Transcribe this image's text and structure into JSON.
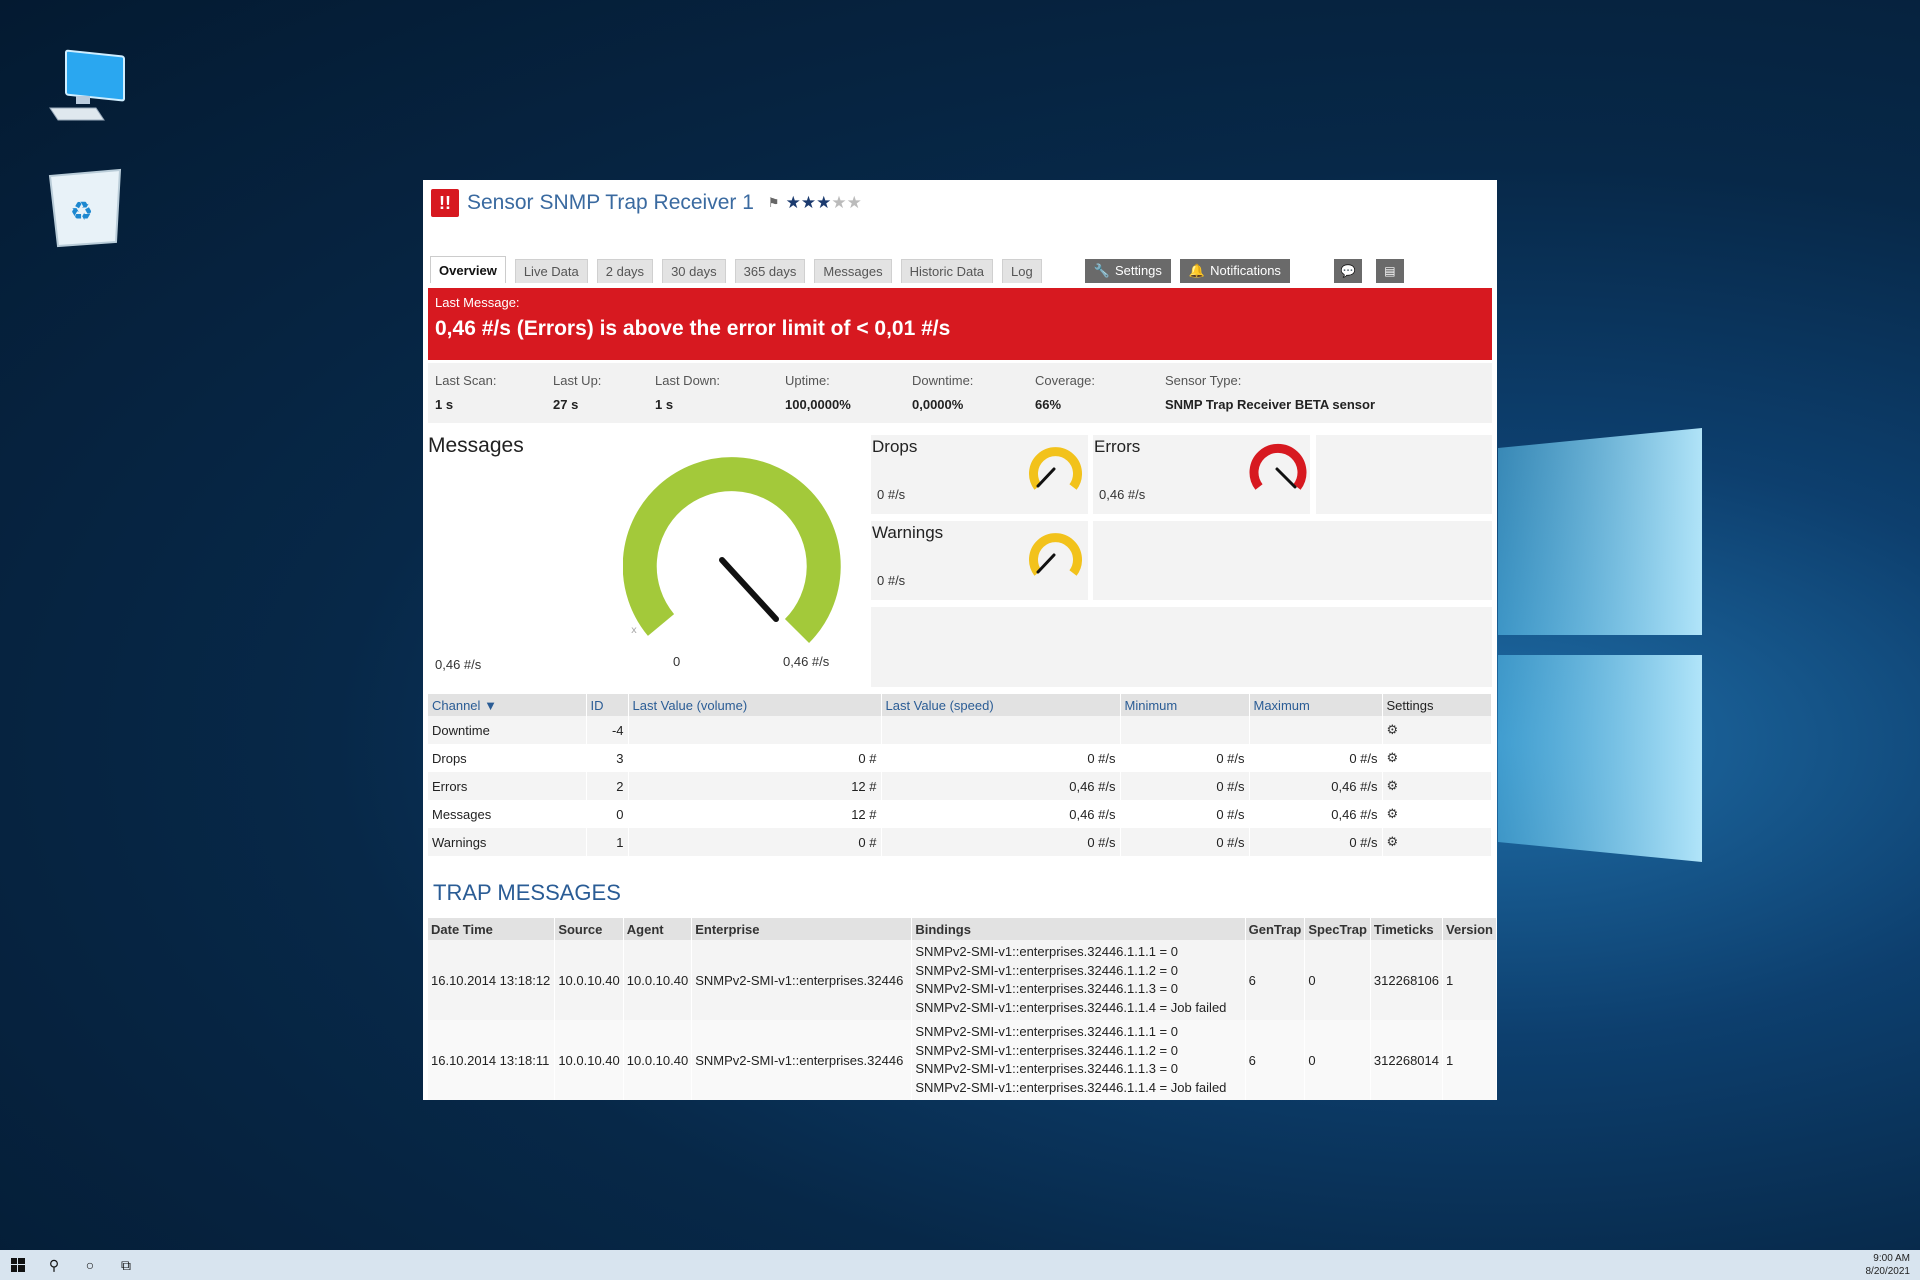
{
  "window": {
    "title_prefix": "Sensor",
    "title_name": "SNMP Trap Receiver 1",
    "status_symbol": "!!",
    "priority_stars_filled": 3,
    "priority_stars_total": 5,
    "colors": {
      "error_red": "#d71920",
      "link_blue": "#2a5c95",
      "gauge_green": "#a3c93a",
      "gauge_yellow": "#f2c21b"
    }
  },
  "tabs": {
    "overview": "Overview",
    "live_data": "Live Data",
    "two_days": "2 days",
    "thirty_days": "30 days",
    "days365": "365 days",
    "messages": "Messages",
    "historic_data": "Historic Data",
    "log": "Log",
    "settings": "Settings",
    "notifications": "Notifications"
  },
  "alert": {
    "label": "Last Message:",
    "text": "0,46 #/s (Errors) is above the error limit of < 0,01 #/s"
  },
  "stats": {
    "last_scan_label": "Last Scan:",
    "last_scan": "1 s",
    "last_up_label": "Last Up:",
    "last_up": "27 s",
    "last_down_label": "Last Down:",
    "last_down": "1 s",
    "uptime_label": "Uptime:",
    "uptime": "100,0000%",
    "downtime_label": "Downtime:",
    "downtime": "0,0000%",
    "coverage_label": "Coverage:",
    "coverage": "66%",
    "sensor_type_label": "Sensor Type:",
    "sensor_type": "SNMP Trap Receiver BETA sensor"
  },
  "gauges": {
    "messages": {
      "title": "Messages",
      "value": "0,46 #/s",
      "min": "0",
      "max": "0,46 #/s"
    },
    "drops": {
      "title": "Drops",
      "value": "0 #/s"
    },
    "errors": {
      "title": "Errors",
      "value": "0,46 #/s"
    },
    "warnings": {
      "title": "Warnings",
      "value": "0 #/s"
    }
  },
  "channels": {
    "headers": {
      "channel": "Channel",
      "id": "ID",
      "last_volume": "Last Value (volume)",
      "last_speed": "Last Value (speed)",
      "minimum": "Minimum",
      "maximum": "Maximum",
      "settings": "Settings"
    },
    "rows": [
      {
        "channel": "Downtime",
        "id": "-4",
        "volume": "",
        "speed": "",
        "minimum": "",
        "maximum": ""
      },
      {
        "channel": "Drops",
        "id": "3",
        "volume": "0 #",
        "speed": "0 #/s",
        "minimum": "0 #/s",
        "maximum": "0 #/s"
      },
      {
        "channel": "Errors",
        "id": "2",
        "volume": "12 #",
        "speed": "0,46 #/s",
        "minimum": "0 #/s",
        "maximum": "0,46 #/s"
      },
      {
        "channel": "Messages",
        "id": "0",
        "volume": "12 #",
        "speed": "0,46 #/s",
        "minimum": "0 #/s",
        "maximum": "0,46 #/s"
      },
      {
        "channel": "Warnings",
        "id": "1",
        "volume": "0 #",
        "speed": "0 #/s",
        "minimum": "0 #/s",
        "maximum": "0 #/s"
      }
    ]
  },
  "trap": {
    "title": "TRAP MESSAGES",
    "headers": {
      "datetime": "Date Time",
      "source": "Source",
      "agent": "Agent",
      "enterprise": "Enterprise",
      "bindings": "Bindings",
      "gentrap": "GenTrap",
      "spectrap": "SpecTrap",
      "timeticks": "Timeticks",
      "version": "Version"
    },
    "rows": [
      {
        "datetime": "16.10.2014 13:18:12",
        "source": "10.0.10.40",
        "agent": "10.0.10.40",
        "enterprise": "SNMPv2-SMI-v1::enterprises.32446",
        "bindings": [
          "SNMPv2-SMI-v1::enterprises.32446.1.1.1 = 0",
          "SNMPv2-SMI-v1::enterprises.32446.1.1.2 = 0",
          "SNMPv2-SMI-v1::enterprises.32446.1.1.3 = 0",
          "SNMPv2-SMI-v1::enterprises.32446.1.1.4 = Job failed"
        ],
        "gentrap": "6",
        "spectrap": "0",
        "timeticks": "312268106",
        "version": "1"
      },
      {
        "datetime": "16.10.2014 13:18:11",
        "source": "10.0.10.40",
        "agent": "10.0.10.40",
        "enterprise": "SNMPv2-SMI-v1::enterprises.32446",
        "bindings": [
          "SNMPv2-SMI-v1::enterprises.32446.1.1.1 = 0",
          "SNMPv2-SMI-v1::enterprises.32446.1.1.2 = 0",
          "SNMPv2-SMI-v1::enterprises.32446.1.1.3 = 0",
          "SNMPv2-SMI-v1::enterprises.32446.1.1.4 = Job failed"
        ],
        "gentrap": "6",
        "spectrap": "0",
        "timeticks": "312268014",
        "version": "1"
      }
    ]
  },
  "taskbar": {
    "time": "9:00 AM",
    "date": "8/20/2021"
  }
}
